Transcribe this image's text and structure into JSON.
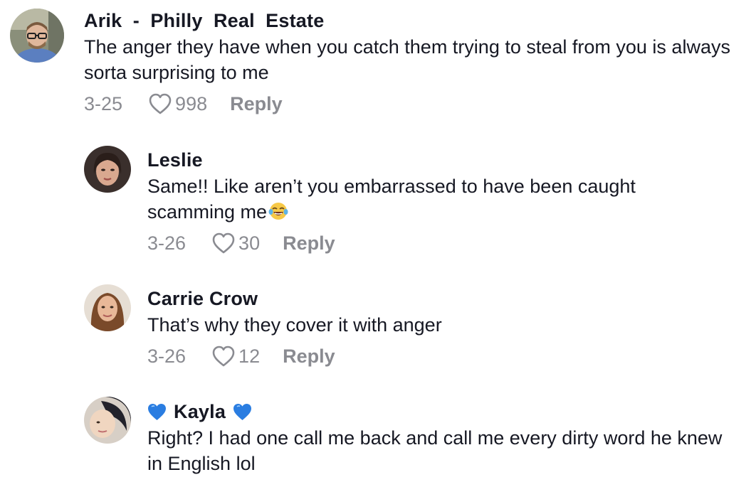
{
  "colors": {
    "text": "#161823",
    "secondary": "#8a8b91",
    "heart_emoji": "#1e6fd9",
    "background": "#ffffff"
  },
  "comments": [
    {
      "username": "Arik  -  Philly  Real  Estate",
      "text": "The anger they have when you catch them trying to steal from you is always sorta surprising to me",
      "date": "3-25",
      "likes": "998",
      "reply_label": "Reply",
      "icon": "heart-outline-icon"
    },
    {
      "username": "Leslie",
      "text": "Same!! Like aren’t you embarrassed to have been caught scamming me",
      "emoji": "tears-of-joy-emoji-icon",
      "date": "3-26",
      "likes": "30",
      "reply_label": "Reply",
      "icon": "heart-outline-icon"
    },
    {
      "username": "Carrie Crow",
      "text": "That’s why they cover it with anger",
      "date": "3-26",
      "likes": "12",
      "reply_label": "Reply",
      "icon": "heart-outline-icon"
    },
    {
      "username": "Kayla",
      "name_decoration": "blue-heart-emoji-icon",
      "text": "Right? I had one call me back and call me every dirty word he knew in English lol"
    }
  ]
}
